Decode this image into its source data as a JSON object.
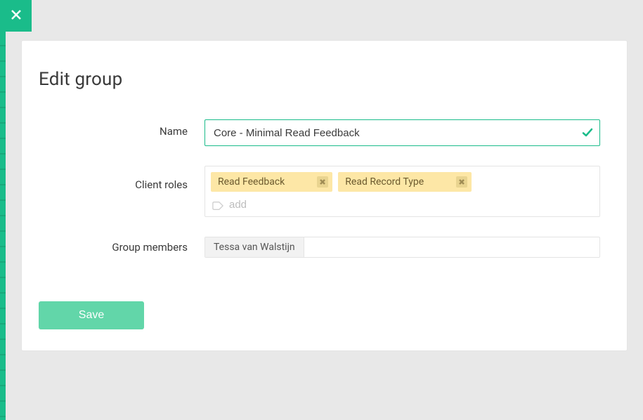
{
  "page_title": "Edit group",
  "labels": {
    "name": "Name",
    "client_roles": "Client roles",
    "group_members": "Group members"
  },
  "form": {
    "name_value": "Core - Minimal Read Feedback",
    "add_placeholder": "add"
  },
  "client_roles": [
    {
      "label": "Read Feedback"
    },
    {
      "label": "Read Record Type"
    }
  ],
  "group_members": [
    {
      "name": "Tessa van Walstijn"
    }
  ],
  "buttons": {
    "save": "Save"
  }
}
